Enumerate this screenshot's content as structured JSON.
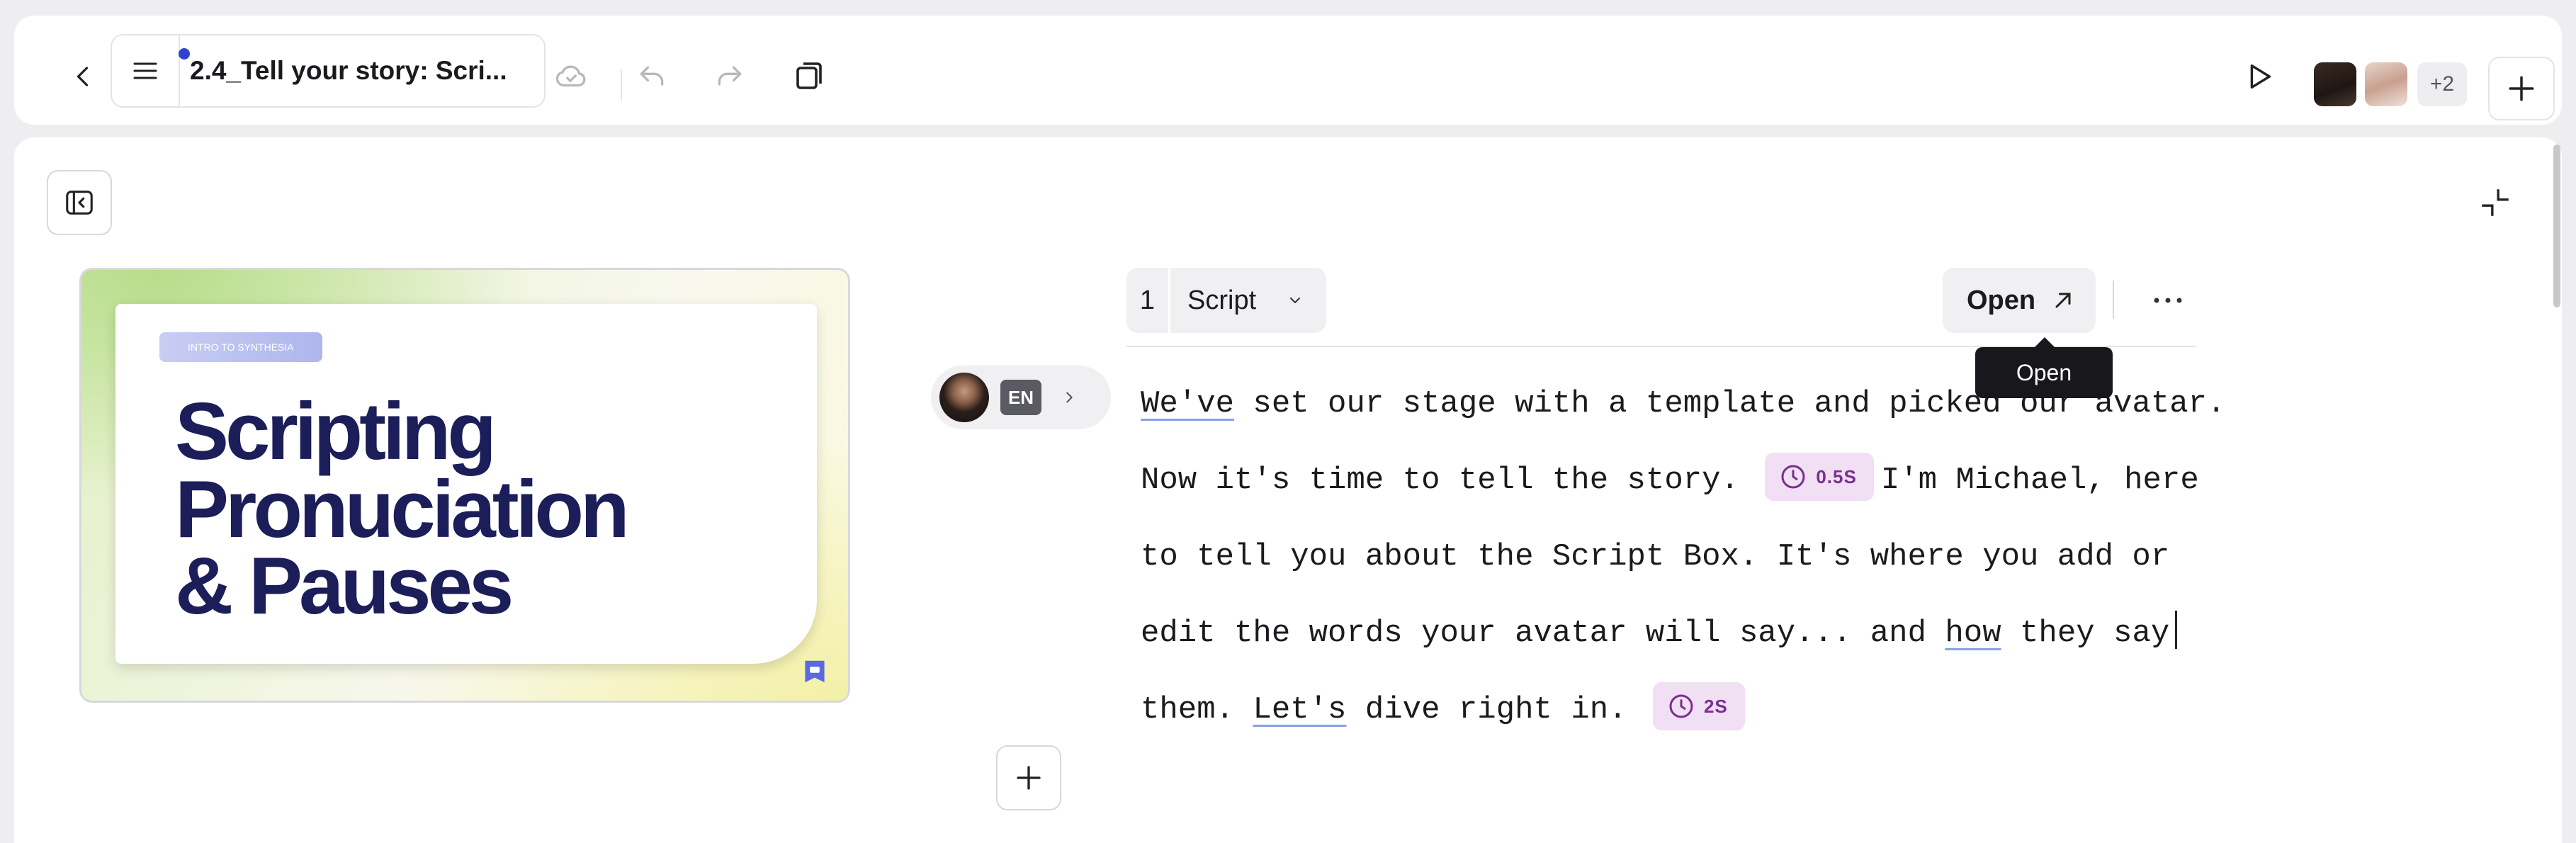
{
  "header": {
    "document_title": "2.4_Tell your story: Scri...",
    "collaborators_more": "+2"
  },
  "icons": {
    "back": "chevron-left-icon",
    "menu": "hamburger-icon",
    "cloud": "cloud-sync-icon",
    "undo": "undo-icon",
    "redo": "redo-icon",
    "duplicate": "copy-icon",
    "play": "play-icon",
    "add": "plus-icon"
  },
  "slide": {
    "tag": "INTRO TO SYNTHESIA",
    "heading_lines": [
      "Scripting",
      "Pronuciation",
      "& Pauses"
    ]
  },
  "avatar": {
    "language": "EN"
  },
  "script": {
    "scene_number": "1",
    "scene_label": "Script",
    "open_label": "Open",
    "tooltip": "Open",
    "lines": {
      "l1_a": "We've",
      "l1_b": " set our stage with a template and picked our avatar.",
      "l2_a": "Now it's time to tell the story.",
      "l2_pause": "0.5S",
      "l2_b": "I'm Michael, here",
      "l3": "to tell you about the Script Box.  It's where you add or",
      "l4_a": "edit the words your avatar will say... and ",
      "l4_b": "how",
      "l4_c": " they say",
      "l5_a": "them.  ",
      "l5_b": "Let's",
      "l5_c": " dive right in.",
      "l5_pause": "2S"
    }
  },
  "colors": {
    "accent_blue": "#3040d0",
    "slide_heading": "#1c1e5a",
    "pause_bg": "#f1dff4",
    "pause_text": "#7a2f8f",
    "tooltip_bg": "#18181c"
  }
}
